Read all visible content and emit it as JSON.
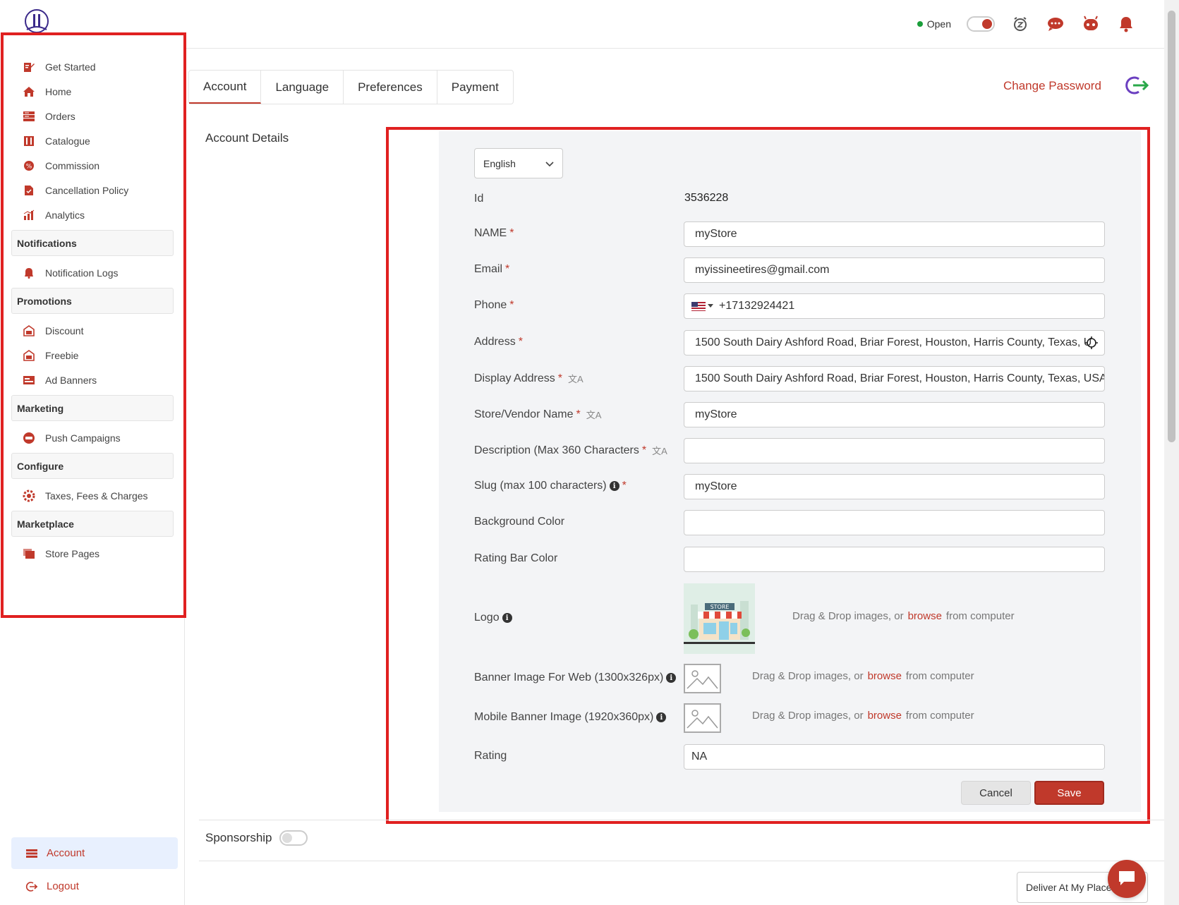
{
  "header": {
    "status_label": "Open",
    "icons": [
      "snooze-icon",
      "support-chat-icon",
      "bot-icon",
      "bell-icon"
    ]
  },
  "sidebar": {
    "items": [
      {
        "label": "Get Started",
        "icon": "edit-icon"
      },
      {
        "label": "Home",
        "icon": "home-icon"
      },
      {
        "label": "Orders",
        "icon": "orders-icon"
      },
      {
        "label": "Catalogue",
        "icon": "catalogue-icon"
      },
      {
        "label": "Commission",
        "icon": "commission-icon"
      },
      {
        "label": "Cancellation Policy",
        "icon": "policy-icon"
      },
      {
        "label": "Analytics",
        "icon": "analytics-icon"
      }
    ],
    "sections": [
      {
        "title": "Notifications",
        "items": [
          {
            "label": "Notification Logs",
            "icon": "bell-icon"
          }
        ]
      },
      {
        "title": "Promotions",
        "items": [
          {
            "label": "Discount",
            "icon": "discount-icon"
          },
          {
            "label": "Freebie",
            "icon": "freebie-icon"
          },
          {
            "label": "Ad Banners",
            "icon": "ad-banner-icon"
          }
        ]
      },
      {
        "title": "Marketing",
        "items": [
          {
            "label": "Push Campaigns",
            "icon": "push-campaign-icon"
          }
        ]
      },
      {
        "title": "Configure",
        "items": [
          {
            "label": "Taxes, Fees & Charges",
            "icon": "gear-icon"
          }
        ]
      },
      {
        "title": "Marketplace",
        "items": [
          {
            "label": "Store Pages",
            "icon": "store-pages-icon"
          }
        ]
      }
    ],
    "bottom": {
      "account": "Account",
      "logout": "Logout"
    }
  },
  "tabs": [
    "Account",
    "Language",
    "Preferences",
    "Payment"
  ],
  "active_tab": "Account",
  "change_password": "Change Password",
  "section_title": "Account Details",
  "form": {
    "language": "English",
    "id_label": "Id",
    "id_value": "3536228",
    "name_label": "NAME",
    "name_value": "myStore",
    "email_label": "Email",
    "email_value": "myissineetires@gmail.com",
    "phone_label": "Phone",
    "phone_value": "+17132924421",
    "address_label": "Address",
    "address_value": "1500 South Dairy Ashford Road, Briar Forest, Houston, Harris County, Texas, U",
    "display_address_label": "Display Address",
    "display_address_value": "1500 South Dairy Ashford Road, Briar Forest, Houston, Harris County, Texas, USA",
    "store_name_label": "Store/Vendor Name",
    "store_name_value": "myStore",
    "description_label": "Description (Max 360 Characters",
    "description_value": "",
    "slug_label": "Slug (max 100 characters)",
    "slug_value": "myStore",
    "bg_color_label": "Background Color",
    "bg_color_value": "",
    "rating_bar_color_label": "Rating Bar Color",
    "rating_bar_color_value": "",
    "logo_label": "Logo",
    "banner_web_label": "Banner Image For Web (1300x326px)",
    "banner_mobile_label": "Mobile Banner Image (1920x360px)",
    "drop_prefix": "Drag & Drop images, or",
    "drop_browse": "browse",
    "drop_suffix": "from computer",
    "logo_sign_text": "STORE",
    "rating_label": "Rating",
    "rating_value": "NA",
    "cancel": "Cancel",
    "save": "Save"
  },
  "sponsorship_label": "Sponsorship",
  "deliver_select": "Deliver At My Place",
  "colors": {
    "accent": "#c0392b",
    "highlight": "#e02020",
    "panel": "#f3f4f6"
  }
}
